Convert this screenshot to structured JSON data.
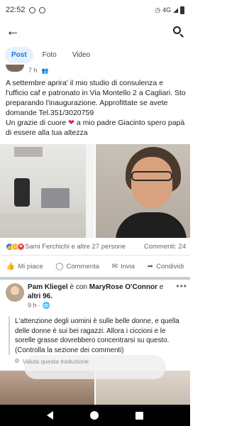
{
  "status_bar": {
    "time": "22:52",
    "network": "4G",
    "icons": [
      "messenger-icon",
      "whatsapp-icon",
      "clock-icon",
      "signal-icon",
      "battery-icon"
    ]
  },
  "appbar": {
    "back_icon": "back-arrow-icon",
    "search_icon": "search-icon"
  },
  "tabs": [
    {
      "label": "Post",
      "active": true
    },
    {
      "label": "Foto",
      "active": false
    },
    {
      "label": "Video",
      "active": false
    }
  ],
  "post1": {
    "time": "7 h",
    "audience_icon": "friends-icon",
    "text_a": "A settembre aprira' il mio studio di consulenza e l'ufficio caf e patronato in Via Montello 2 a Cagliari. Sto preparando l'inaugurazione. Approfittate se avete domande Tel.351/3020759",
    "text_b_pre": "Un grazie di cuore ",
    "text_b_post": " a mio padre Giacinto spero papà di essere alla tua altezza",
    "reactions_text": "Sami Ferchichi e altre 27 persone",
    "comments_text": "Commenti: 24",
    "actions": {
      "like": "Mi piace",
      "comment": "Commenta",
      "send": "Invia",
      "share": "Condividi"
    }
  },
  "post2": {
    "author": "Pam Kliegel",
    "connector": " è con ",
    "tagged": "MaryRose O'Connor",
    "connector2": " e ",
    "others": "altri 96",
    "time": "9 h",
    "body": "L'attenzione degli uomini è sulle belle donne, e quella delle donne è sui bei ragazzi. Allora i ciccioni e le sorelle grasse dovrebbero concentrarsi su questo. (Controlla la sezione dei commenti)",
    "translate": "Valuta questa traduzione"
  },
  "colors": {
    "accent": "#1877f2",
    "tab_active_bg": "#e7f0fd",
    "heart": "#e0245e"
  }
}
